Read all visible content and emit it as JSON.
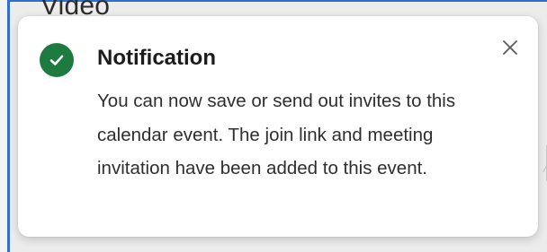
{
  "background": {
    "heading": "Video"
  },
  "notification": {
    "title": "Notification",
    "message": "You can now save or send out invites to this calendar event. The join link and meeting invitation have been added to this event.",
    "status_icon": "check-circle-icon",
    "close_icon": "close-icon"
  },
  "colors": {
    "success": "#1e7b3f",
    "accent_border": "#2f6fd0"
  }
}
